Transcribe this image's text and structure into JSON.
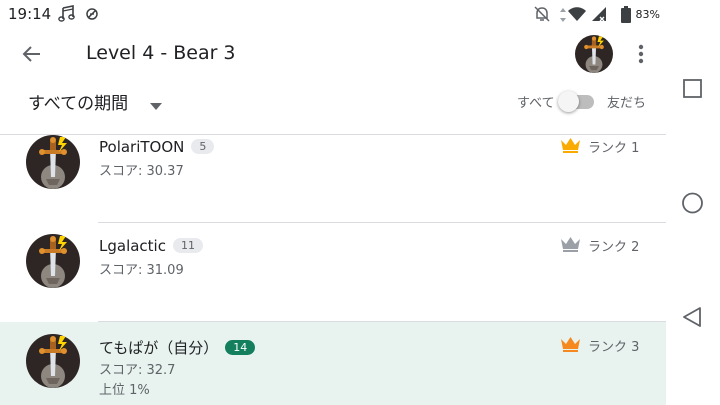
{
  "status_bar": {
    "time": "19:14",
    "battery": "83%",
    "icons": [
      "music-note-icon",
      "vibrate-off-icon",
      "notifications-off-icon",
      "wifi-icon",
      "signal-icon",
      "battery-icon"
    ]
  },
  "app_bar": {
    "title": "Level 4 - Bear 3",
    "back_icon": "arrow-back-icon",
    "more_icon": "more-vert-icon"
  },
  "filter": {
    "period": "すべての期間",
    "toggle_left": "すべて",
    "toggle_right": "友だち",
    "toggle_on": false
  },
  "entries": [
    {
      "name": "PolariTOON",
      "badge": "5",
      "score": "スコア: 30.37",
      "rank": "ランク 1",
      "crown_color": "#f9ab00"
    },
    {
      "name": "Lgalactic",
      "badge": "11",
      "score": "スコア: 31.09",
      "rank": "ランク 2",
      "crown_color": "#9aa0a6"
    },
    {
      "name": "てもぱが（自分）",
      "badge": "14",
      "score": "スコア: 32.7",
      "percentile": "上位 1%",
      "rank": "ランク 3",
      "crown_color": "#f5891f",
      "is_self": true
    }
  ],
  "nav": [
    "recents-square-icon",
    "home-circle-icon",
    "back-triangle-icon"
  ]
}
